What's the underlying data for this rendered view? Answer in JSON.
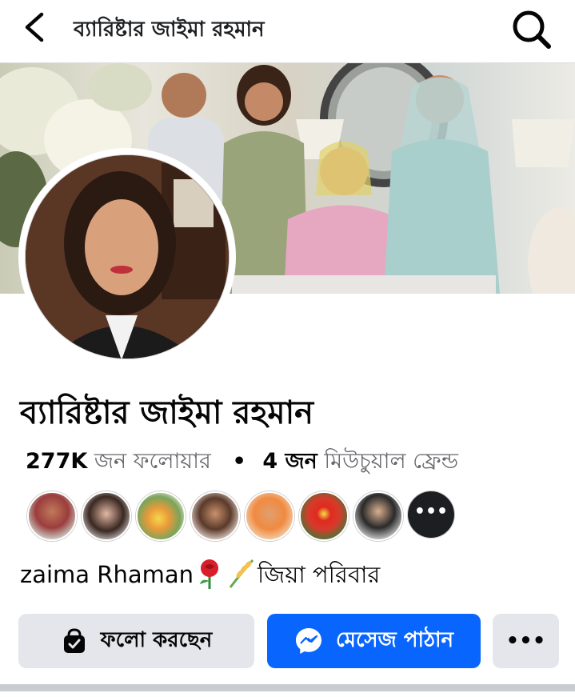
{
  "header": {
    "title": "ব্যারিষ্টার জাইমা রহমান",
    "back_icon": "back-arrow-icon",
    "search_icon": "search-icon"
  },
  "profile": {
    "name": "ব্যারিষ্টার জাইমা রহমান",
    "followers_count": "277K",
    "followers_label": "জন ফলোয়ার",
    "separator": "•",
    "mutual_count": "4 জন",
    "mutual_label": "মিউচুয়াল ফ্রেন্ড",
    "bio": "zaima Rhaman",
    "bio_suffix": "জিয়া পরিবার",
    "bio_emojis": [
      "rose-icon",
      "rice-sheaf-icon"
    ]
  },
  "mutual_friends": {
    "avatars": [
      "mutual-friend-1",
      "mutual-friend-2",
      "mutual-friend-3",
      "mutual-friend-4",
      "mutual-friend-5",
      "mutual-friend-6",
      "mutual-friend-7"
    ],
    "more_label": "•••"
  },
  "actions": {
    "follow_label": "ফলো করছেন",
    "message_label": "মেসেজ পাঠান",
    "more_label": "•••"
  },
  "colors": {
    "primary": "#0866ff",
    "secondary_button": "#e4e6eb",
    "text_secondary": "#65676b"
  }
}
